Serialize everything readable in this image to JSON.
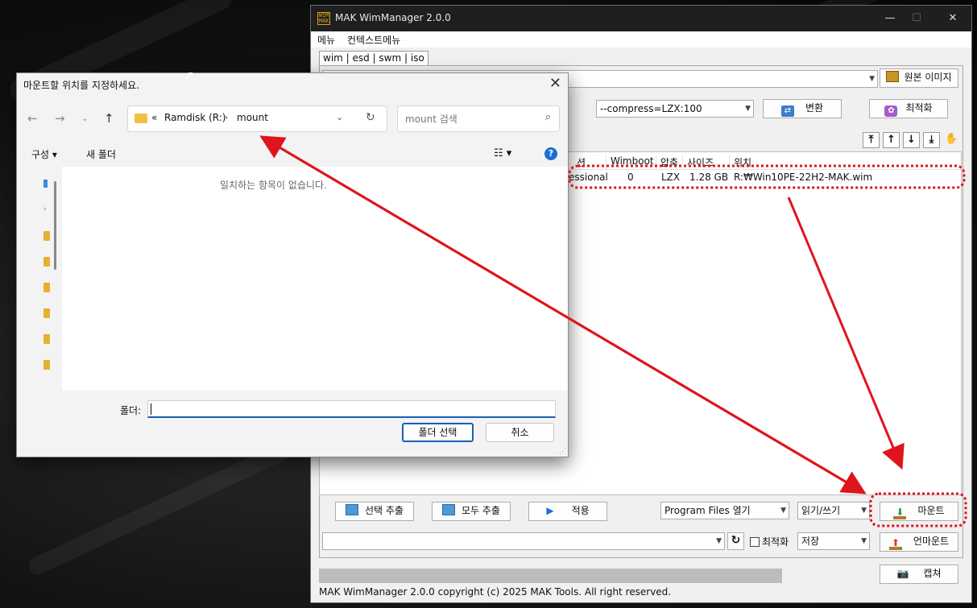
{
  "main": {
    "title": "MAK WimManager 2.0.0",
    "app_icon_text": "WIM MAK",
    "window_controls": {
      "minimize": "—",
      "maximize": "☐",
      "close": "✕"
    },
    "menu": [
      "메뉴",
      "컨텍스트메뉴"
    ],
    "tab_label": "wim | esd | swm | iso",
    "source_path": "",
    "source_button": "원본 이미지",
    "compress_option": "--compress=LZX:100",
    "convert_button": "변환",
    "optimize_button": "최적화",
    "columns": [
      "션",
      "Wimboot",
      "압축",
      "사이즈",
      "위치"
    ],
    "rows": [
      {
        "edition": "essional",
        "wimboot": "0",
        "compression": "LZX",
        "size": "1.28 GB",
        "location": "R:₩Win10PE-22H2-MAK.wim"
      }
    ],
    "extract_selected": "선택 추출",
    "extract_all": "모두 추출",
    "apply_button": "적용",
    "open_option": "Program Files 열기",
    "access_mode": "읽기/쓰기",
    "mount_button": "마운트",
    "mount_path": "",
    "optimize_check_label": "최적화",
    "save_option": "저장",
    "unmount_button": "언마운트",
    "capture_button": "캡쳐",
    "status": "MAK WimManager 2.0.0 copyright (c) 2025 MAK Tools. All right reserved."
  },
  "dialog": {
    "title": "마운트할 위치를 지정하세요.",
    "breadcrumb_overflow": "«",
    "breadcrumb": [
      "Ramdisk (R:)",
      "mount"
    ],
    "search_placeholder": "mount 검색",
    "organize": "구성 ▾",
    "new_folder": "새 폴더",
    "empty_message": "일치하는 항목이 없습니다.",
    "folder_label": "폴더:",
    "folder_value": "",
    "select_button": "폴더 선택",
    "cancel_button": "취소",
    "help": "?"
  },
  "colors": {
    "annotation": "#e0141c",
    "titlebar": "#1f1f1f",
    "accent": "#1a5fb4"
  }
}
